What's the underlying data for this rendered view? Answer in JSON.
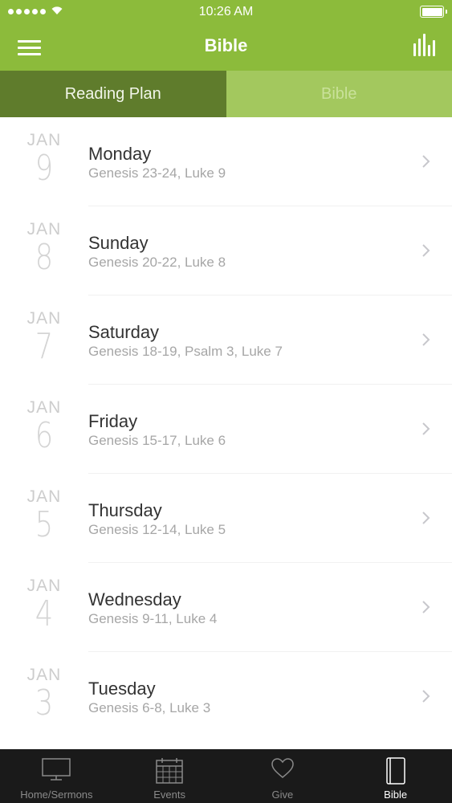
{
  "status_bar": {
    "time": "10:26 AM"
  },
  "nav": {
    "title": "Bible",
    "menu_icon": "hamburger-menu-icon",
    "stats_icon": "bar-chart-icon"
  },
  "segments": [
    {
      "label": "Reading Plan",
      "selected": true
    },
    {
      "label": "Bible",
      "selected": false
    }
  ],
  "readings": [
    {
      "month": "JAN",
      "day": "9",
      "weekday": "Monday",
      "passage": "Genesis 23-24, Luke 9"
    },
    {
      "month": "JAN",
      "day": "8",
      "weekday": "Sunday",
      "passage": "Genesis 20-22, Luke 8"
    },
    {
      "month": "JAN",
      "day": "7",
      "weekday": "Saturday",
      "passage": "Genesis 18-19, Psalm 3, Luke 7"
    },
    {
      "month": "JAN",
      "day": "6",
      "weekday": "Friday",
      "passage": "Genesis 15-17, Luke 6"
    },
    {
      "month": "JAN",
      "day": "5",
      "weekday": "Thursday",
      "passage": "Genesis 12-14, Luke 5"
    },
    {
      "month": "JAN",
      "day": "4",
      "weekday": "Wednesday",
      "passage": "Genesis 9-11, Luke 4"
    },
    {
      "month": "JAN",
      "day": "3",
      "weekday": "Tuesday",
      "passage": "Genesis 6-8, Luke 3"
    }
  ],
  "tabs": [
    {
      "label": "Home/Sermons",
      "icon": "monitor-icon",
      "active": false
    },
    {
      "label": "Events",
      "icon": "calendar-icon",
      "active": false
    },
    {
      "label": "Give",
      "icon": "heart-icon",
      "active": false
    },
    {
      "label": "Bible",
      "icon": "book-icon",
      "active": true
    }
  ],
  "colors": {
    "header_green": "#8cbb3b",
    "segment_active": "#5f7c2c",
    "segment_inactive": "#a3c85e",
    "tabbar_bg": "#1a1a1a"
  }
}
